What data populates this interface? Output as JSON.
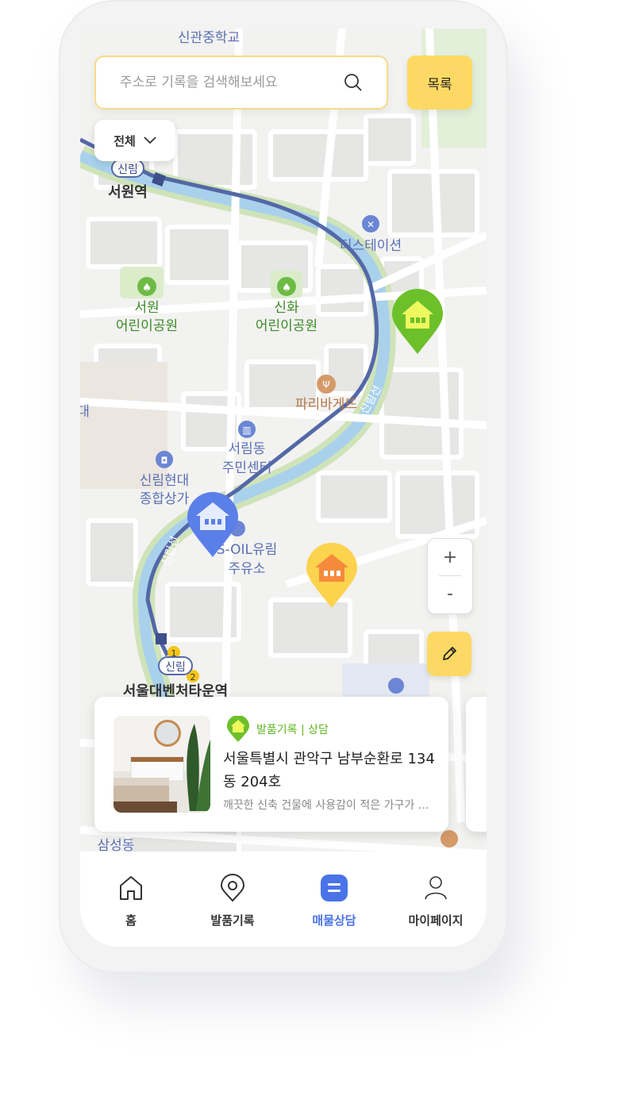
{
  "search": {
    "placeholder": "주소로 기록을 검색해보세요",
    "icon": "search-icon"
  },
  "list_button": {
    "label": "목록"
  },
  "filter": {
    "label": "전체",
    "icon": "chevron-down-icon"
  },
  "map": {
    "labels": {
      "school": "신관중학교",
      "station1_badge": "신림",
      "station1_name": "서원역",
      "station2_badge": "신림",
      "station2_name": "서울대벤처타운역",
      "gas_station": "티스테이션",
      "park1_line1": "서원",
      "park1_line2": "어린이공원",
      "park2_line1": "신화",
      "park2_line2": "어린이공원",
      "bakery": "파리바게뜨",
      "center_line1": "서림동",
      "center_line2": "주민센터",
      "mall_line1": "신림현대",
      "mall_line2": "종합상가",
      "oil_line1": "S-OIL유림",
      "oil_line2": "주유소",
      "line_label": "신림선",
      "line_label2": "신림선",
      "area": "삼성동",
      "edge_char": "대",
      "num1": "1",
      "num2": "2"
    },
    "colors": {
      "rail": "#5468a8",
      "water": "#a9d1ec",
      "green_marker": "#6cc02a",
      "blue_marker": "#5b7fe8",
      "yellow_marker": "#fcd34d"
    }
  },
  "zoom": {
    "plus": "+",
    "minus": "-"
  },
  "card": {
    "tag": "발품기록  |  상담",
    "address": "서울특별시 관악구 남부순환로 134동 204호",
    "description": "깨끗한 신축 건물에 사용감이 적은 가구가 있습니다"
  },
  "tabs": [
    {
      "label": "홈",
      "icon": "home-icon",
      "active": false
    },
    {
      "label": "발품기록",
      "icon": "location-pin-icon",
      "active": false
    },
    {
      "label": "매물상담",
      "icon": "chat-icon",
      "active": true
    },
    {
      "label": "마이페이지",
      "icon": "person-icon",
      "active": false
    }
  ]
}
